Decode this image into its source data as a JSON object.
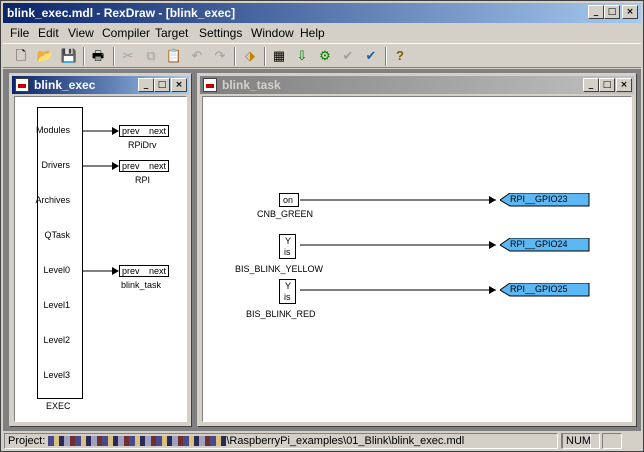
{
  "window": {
    "title": "blink_exec.mdl - RexDraw - [blink_exec]",
    "min_glyph": "_",
    "max_glyph": "□",
    "close_glyph": "×"
  },
  "menu": [
    "File",
    "Edit",
    "View",
    "Compiler",
    "Target",
    "Settings",
    "Window",
    "Help"
  ],
  "toolbar": {
    "icons": [
      "new-icon",
      "open-icon",
      "save-icon",
      "print-icon",
      "cut-icon",
      "copy-icon",
      "paste-icon",
      "undo-icon",
      "redo-icon",
      "target-icon",
      "compile-icon",
      "download-icon",
      "watch-icon",
      "diagnostics-icon",
      "help-icon"
    ],
    "glyphs": {
      "new": "🗋",
      "open": "📂",
      "save": "💾",
      "print": "🖶",
      "cut": "✂",
      "copy": "⧉",
      "paste": "📋",
      "undo": "↶",
      "redo": "↷",
      "target": "⬗",
      "compile": "▦",
      "download": "⇩",
      "watch": "⚙",
      "diagnostics": "✔",
      "help": "?"
    }
  },
  "exec_window": {
    "title": "blink_exec",
    "block_name": "EXEC",
    "ports": [
      "Modules",
      "Drivers",
      "Archives",
      "QTask",
      "Level0",
      "Level1",
      "Level2",
      "Level3"
    ],
    "links": [
      {
        "prev": "prev",
        "next": "next",
        "name": "RPiDrv"
      },
      {
        "prev": "prev",
        "next": "next",
        "name": "RPI"
      },
      {
        "prev": "prev",
        "next": "next",
        "name": "blink_task"
      }
    ]
  },
  "task_window": {
    "title": "blink_task",
    "blocks": [
      {
        "name": "CNB_GREEN",
        "port_out": "on",
        "port_in": ""
      },
      {
        "name": "BIS_BLINK_YELLOW",
        "port_out": "Y",
        "port_in": "is"
      },
      {
        "name": "BIS_BLINK_RED",
        "port_out": "Y",
        "port_in": "is"
      }
    ],
    "outputs": [
      "RPI__GPIO23",
      "RPI__GPIO24",
      "RPI__GPIO25"
    ],
    "output_color": "#5bb8f5"
  },
  "status": {
    "project_label": "Project:",
    "path": "\\RaspberryPi_examples\\01_Blink\\blink_exec.mdl",
    "num": "NUM"
  }
}
